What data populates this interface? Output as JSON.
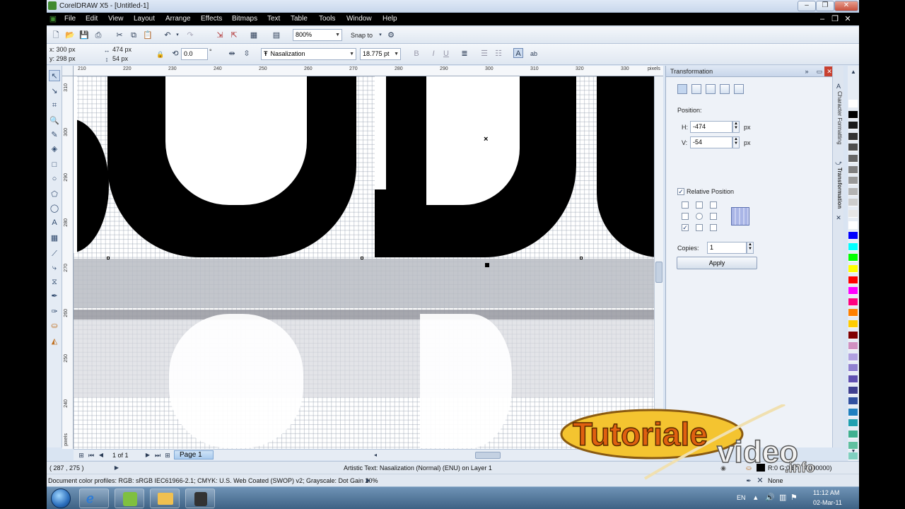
{
  "window": {
    "title": "CorelDRAW X5 - [Untitled-1]"
  },
  "menu": [
    "File",
    "Edit",
    "View",
    "Layout",
    "Arrange",
    "Effects",
    "Bitmaps",
    "Text",
    "Table",
    "Tools",
    "Window",
    "Help"
  ],
  "toolbar": {
    "zoom": "800%",
    "snap_to": "Snap to"
  },
  "property_bar": {
    "x": "x: 300 px",
    "y": "y: 298 px",
    "width": "474 px",
    "height": "54 px",
    "rotation": "0.0",
    "rotation_unit": "°",
    "font_name": "Nasalization",
    "font_size": "18.775 pt"
  },
  "rulers": {
    "h_ticks": [
      "210",
      "220",
      "230",
      "240",
      "250",
      "260",
      "270",
      "280",
      "290",
      "300",
      "310",
      "320",
      "330"
    ],
    "h_unit": "pixels",
    "v_ticks": [
      "310",
      "300",
      "290",
      "280",
      "270",
      "260",
      "250",
      "240"
    ],
    "v_unit": "pixels"
  },
  "page_nav": {
    "count": "1 of 1",
    "tab": "Page 1"
  },
  "status": {
    "coords": "( 287 , 275 )",
    "object_info": "Artistic Text: Nasalization (Normal) (ENU) on Layer 1",
    "color_profiles": "Document color profiles: RGB: sRGB IEC61966-2.1; CMYK: U.S. Web Coated (SWOP) v2; Grayscale: Dot Gain 20%",
    "fill": "R:0 G:0 B:0 (#000000)",
    "outline": "None"
  },
  "docker": {
    "title": "Transformation",
    "position_label": "Position:",
    "h_label": "H:",
    "h_value": "-474",
    "v_label": "V:",
    "v_value": "-54",
    "unit": "px",
    "relative_label": "Relative Position",
    "copies_label": "Copies:",
    "copies_value": "1",
    "apply": "Apply",
    "side_tabs": [
      "Character Formatting",
      "Transformation"
    ]
  },
  "palette_colors": [
    "#ffffff",
    "#000000",
    "#1a1a1a",
    "#333333",
    "#4d4d4d",
    "#666666",
    "#808080",
    "#999999",
    "#b3b3b3",
    "#cccccc",
    "#e6e6e6",
    "#ffffff",
    "#0000ff",
    "#00ffff",
    "#00ff00",
    "#ffff00",
    "#ff0000",
    "#ff00ff",
    "#ff0080",
    "#ff8000",
    "#ffcc00",
    "#800000",
    "#d090c0",
    "#b0a0e0",
    "#9080d0",
    "#6050b0",
    "#404090",
    "#3050a0",
    "#2080c0",
    "#20a0b0",
    "#40b090",
    "#60c0a0",
    "#80d0c0"
  ],
  "taskbar": {
    "lang": "EN",
    "time": "11:12 AM",
    "date": "02-Mar-11"
  },
  "watermark": {
    "word1": "Tutoriale",
    "word2": "video",
    "suffix": ".info"
  }
}
